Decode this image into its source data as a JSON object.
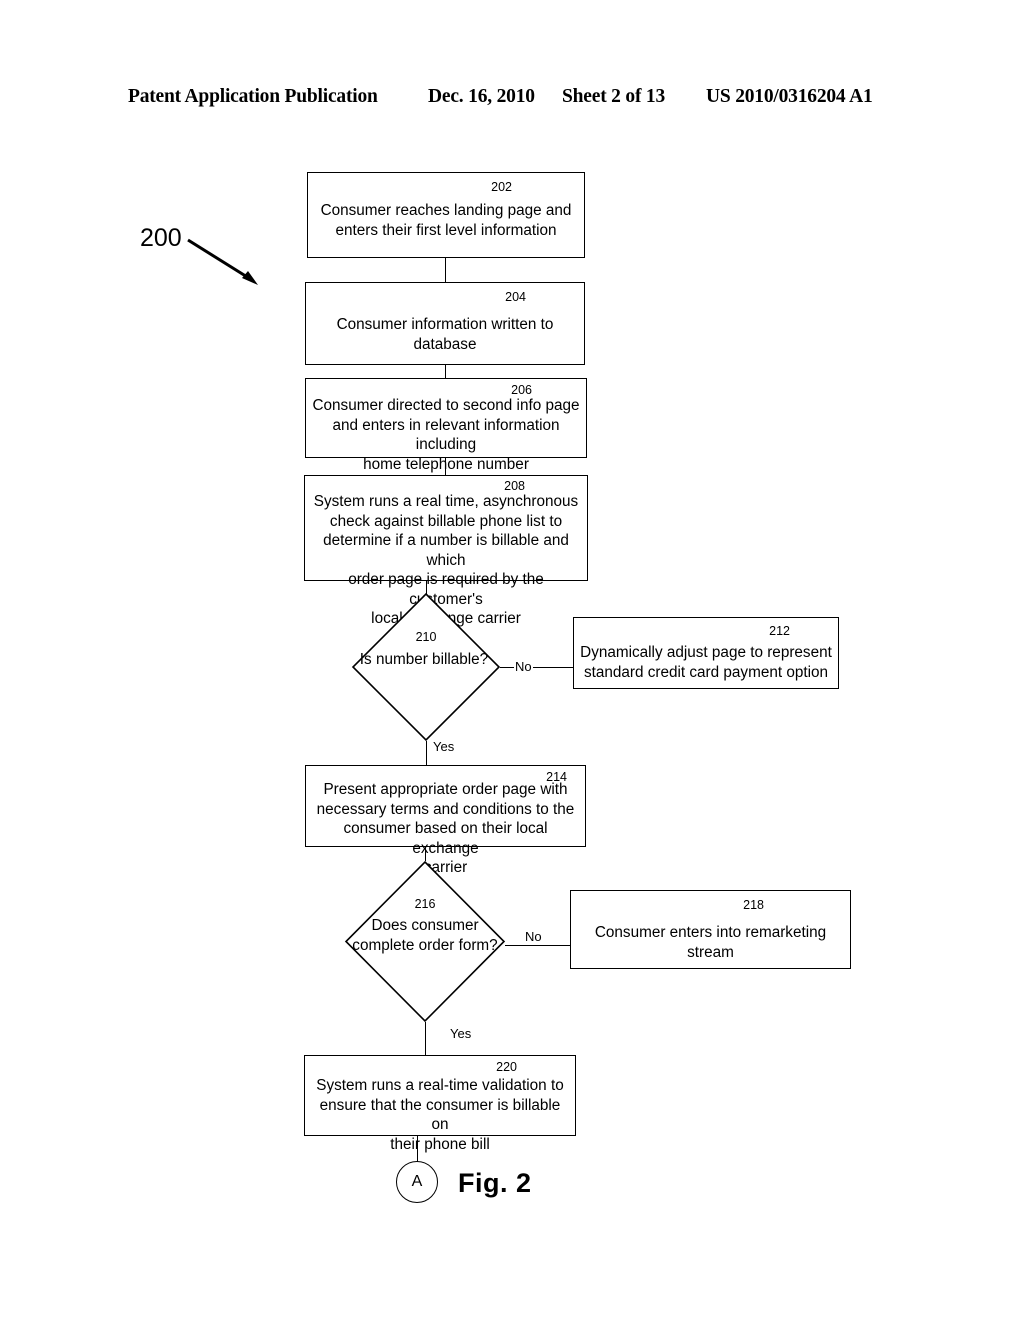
{
  "header": {
    "publication": "Patent Application Publication",
    "date": "Dec. 16, 2010",
    "sheet": "Sheet 2 of 13",
    "publication_number": "US 2010/0316204 A1"
  },
  "figure": {
    "caption": "Fig. 2",
    "diagram_label": "200",
    "offpage_connector": "A"
  },
  "nodes": {
    "n202": {
      "ref": "202",
      "text": "Consumer reaches landing page and\nenters their first level information",
      "type": "process"
    },
    "n204": {
      "ref": "204",
      "text": "Consumer information written to database",
      "type": "process"
    },
    "n206": {
      "ref": "206",
      "text": "Consumer directed to second info page\nand enters in relevant information including\nhome telephone number",
      "type": "process"
    },
    "n208": {
      "ref": "208",
      "text": "System runs a real time, asynchronous\ncheck against billable phone list to\ndetermine if a number is billable and which\norder page is required by the customer's\nlocal exchange carrier",
      "type": "process"
    },
    "n210": {
      "ref": "210",
      "text": "Is number billable?",
      "type": "decision"
    },
    "n212": {
      "ref": "212",
      "text": "Dynamically adjust page to represent\nstandard credit card payment option",
      "type": "process"
    },
    "n214": {
      "ref": "214",
      "text": "Present appropriate order page with\nnecessary terms and conditions to the\nconsumer based on their local exchange\ncarrier",
      "type": "process"
    },
    "n216": {
      "ref": "216",
      "text": "Does consumer\ncomplete order form?",
      "type": "decision"
    },
    "n218": {
      "ref": "218",
      "text": "Consumer enters into remarketing stream",
      "type": "process"
    },
    "n220": {
      "ref": "220",
      "text": "System runs a real-time validation to\nensure that the consumer is billable on\ntheir phone bill",
      "type": "process"
    }
  },
  "edges": {
    "e210_no": "No",
    "e210_yes": "Yes",
    "e216_no": "No",
    "e216_yes": "Yes"
  },
  "colors": {
    "ink": "#000000",
    "paper": "#ffffff"
  }
}
